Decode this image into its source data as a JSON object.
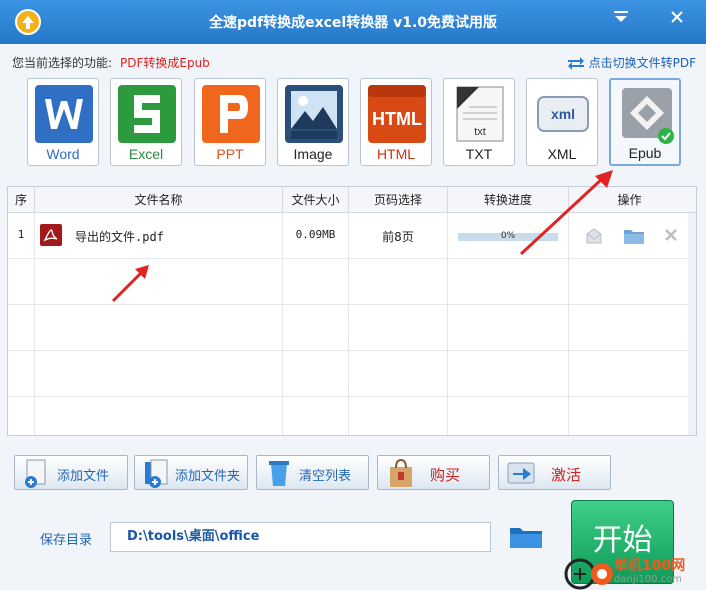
{
  "window": {
    "title": "全速pdf转换成excel转换器 v1.0免费试用版",
    "menu_icon": "dropdown-menu-icon",
    "close_icon": "close-icon"
  },
  "function": {
    "label": "您当前选择的功能:",
    "value": "PDF转换成Epub",
    "switch_link": "点击切换文件转PDF"
  },
  "formats": [
    {
      "label": "Word",
      "color": "#2f6fc4"
    },
    {
      "label": "Excel",
      "color": "#2e8b3c"
    },
    {
      "label": "PPT",
      "color": "#e0501c"
    },
    {
      "label": "Image",
      "color": "#222222"
    },
    {
      "label": "HTML",
      "color": "#d03010"
    },
    {
      "label": "TXT",
      "color": "#222222"
    },
    {
      "label": "XML",
      "color": "#222222"
    },
    {
      "label": "Epub",
      "color": "#222222"
    }
  ],
  "table": {
    "headers": [
      "序",
      "文件名称",
      "文件大小",
      "页码选择",
      "转换进度",
      "操作"
    ],
    "rows": [
      {
        "index": "1",
        "name": "导出的文件.pdf",
        "size": "0.09MB",
        "pages": "前8页",
        "progress": "0%",
        "progress_value": 0
      }
    ]
  },
  "buttons": {
    "add_file": "添加文件",
    "add_folder": "添加文件夹",
    "clear_list": "清空列表",
    "buy": "购买",
    "activate": "激活",
    "start": "开始"
  },
  "save": {
    "label": "保存目录",
    "path": "D:\\tools\\桌面\\office"
  },
  "watermark": {
    "text1": "单机100网",
    "text2": "danji100.com"
  },
  "colors": {
    "accent": "#2478c8",
    "start": "#16a85f",
    "highlight_red": "#e02020"
  }
}
